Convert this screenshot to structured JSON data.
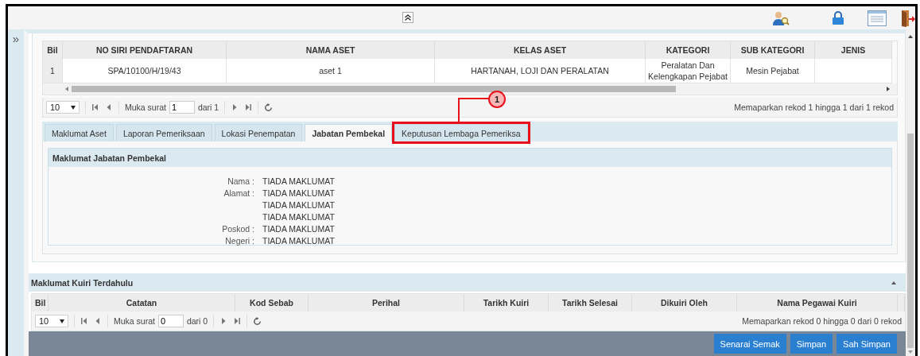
{
  "sidebar": {
    "toggle": "»"
  },
  "asset_table": {
    "columns": [
      "Bil",
      "NO SIRI PENDAFTARAN",
      "NAMA ASET",
      "KELAS ASET",
      "KATEGORI",
      "SUB KATEGORI",
      "JENIS"
    ],
    "rows": [
      [
        "1",
        "SPA/10100/H/19/43",
        "aset 1",
        "HARTANAH, LOJI DAN PERALATAN",
        "Peralatan Dan Kelengkapan Pejabat",
        "Mesin Pejabat",
        ""
      ]
    ],
    "pager": {
      "page_size": "10",
      "page_label": "Muka surat",
      "page": "1",
      "of": "dari 1",
      "summary": "Memaparkan rekod 1 hingga 1 dari 1 rekod"
    }
  },
  "tabs": [
    {
      "label": "Maklumat Aset",
      "selected": false,
      "highlighted": false
    },
    {
      "label": "Laporan Pemeriksaan",
      "selected": false,
      "highlighted": false
    },
    {
      "label": "Lokasi Penempatan",
      "selected": false,
      "highlighted": false
    },
    {
      "label": "Jabatan Pembekal",
      "selected": true,
      "highlighted": false
    },
    {
      "label": "Keputusan Lembaga Pemeriksa",
      "selected": false,
      "highlighted": true
    }
  ],
  "callout": {
    "number": "1"
  },
  "supplier": {
    "title": "Maklumat Jabatan Pembekal",
    "fields": [
      {
        "label": "Nama :",
        "value": "TIADA MAKLUMAT"
      },
      {
        "label": "Alamat :",
        "value": "TIADA MAKLUMAT"
      },
      {
        "value": "TIADA MAKLUMAT"
      },
      {
        "value": "TIADA MAKLUMAT"
      },
      {
        "label": "Poskod :",
        "value": "TIADA MAKLUMAT"
      },
      {
        "label": "Negeri :",
        "value": "TIADA MAKLUMAT"
      }
    ]
  },
  "query_panel": {
    "title": "Maklumat Kuiri Terdahulu",
    "columns": [
      "Bil",
      "Catatan",
      "Kod Sebab",
      "Perihal",
      "Tarikh Kuiri",
      "Tarikh Selesai",
      "Dikuiri Oleh",
      "Nama Pegawai Kuiri"
    ],
    "pager": {
      "page_size": "10",
      "page_label": "Muka surat",
      "page": "0",
      "of": "dari 0",
      "summary": "Memaparkan rekod 0 hingga 0 dari 0 rekod"
    }
  },
  "buttons": [
    "Senarai Semak",
    "Simpan",
    "Sah Simpan"
  ]
}
